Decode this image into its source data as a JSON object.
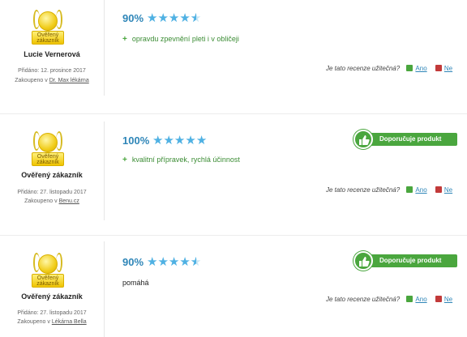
{
  "reviews": [
    {
      "badge_text": "Ověřený zákazník",
      "author": "Lucie Vernerová",
      "added": "Přidáno: 12. prosince 2017",
      "bought_prefix": "Zakoupeno v",
      "bought_shop": "Dr. Max lékárna",
      "score": "90%",
      "rating_fraction": 0.9,
      "pro": "opravdu zpevnění pleti i v obličeji",
      "helpful_question": "Je tato recenze užitečná?",
      "yes_label": "Ano",
      "no_label": "Ne"
    },
    {
      "badge_text": "Ověřený zákazník",
      "author": "Ověřený zákazník",
      "added": "Přidáno: 27. listopadu 2017",
      "bought_prefix": "Zakoupeno v",
      "bought_shop": "Benu.cz",
      "score": "100%",
      "rating_fraction": 1.0,
      "pro": "kvalitní přípravek, rychlá účinnost",
      "recommend_label": "Doporučuje produkt",
      "helpful_question": "Je tato recenze užitečná?",
      "yes_label": "Ano",
      "no_label": "Ne"
    },
    {
      "badge_text": "Ověřený zákazník",
      "author": "Ověřený zákazník",
      "added": "Přidáno: 27. listopadu 2017",
      "bought_prefix": "Zakoupeno v",
      "bought_shop": "Lékárna Bella",
      "score": "90%",
      "rating_fraction": 0.9,
      "text": "pomáhá",
      "recommend_label": "Doporučuje produkt",
      "helpful_question": "Je tato recenze užitečná?",
      "yes_label": "Ano",
      "no_label": "Ne"
    }
  ],
  "icons": {
    "plus": "plus-icon",
    "thumb_up": "thumb-up-icon",
    "thumb_down": "thumb-down-icon",
    "badge": "verified-customer-badge-icon"
  },
  "colors": {
    "accent_blue": "#2f86b8",
    "star_blue": "#4fb1e3",
    "recommend_green": "#4aa63e",
    "dislike_red": "#c23a3a"
  }
}
